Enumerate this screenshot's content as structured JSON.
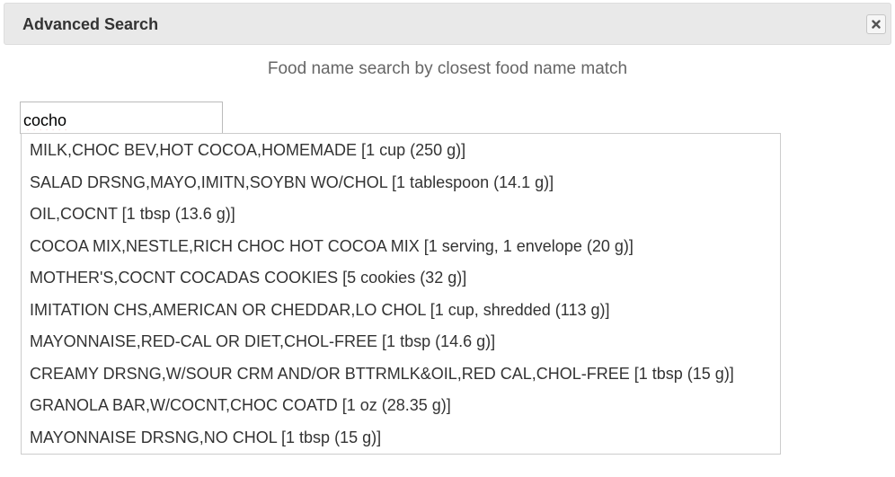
{
  "dialog": {
    "title": "Advanced Search",
    "close_icon": "close-icon"
  },
  "subtitle": "Food name search by closest food name match",
  "search": {
    "value": "cocho",
    "placeholder": ""
  },
  "results": [
    "MILK,CHOC BEV,HOT COCOA,HOMEMADE [1 cup (250 g)]",
    "SALAD DRSNG,MAYO,IMITN,SOYBN WO/CHOL [1 tablespoon (14.1 g)]",
    "OIL,COCNT [1 tbsp (13.6 g)]",
    "COCOA MIX,NESTLE,RICH CHOC HOT COCOA MIX [1 serving, 1 envelope (20 g)]",
    "MOTHER'S,COCNT COCADAS COOKIES [5 cookies (32 g)]",
    "IMITATION CHS,AMERICAN OR CHEDDAR,LO CHOL [1 cup, shredded (113 g)]",
    "MAYONNAISE,RED-CAL OR DIET,CHOL-FREE [1 tbsp (14.6 g)]",
    "CREAMY DRSNG,W/SOUR CRM AND/OR BTTRMLK&OIL,RED CAL,CHOL-FREE [1 tbsp (15 g)]",
    "GRANOLA BAR,W/COCNT,CHOC COATD [1 oz (28.35 g)]",
    "MAYONNAISE DRSNG,NO CHOL [1 tbsp (15 g)]"
  ]
}
